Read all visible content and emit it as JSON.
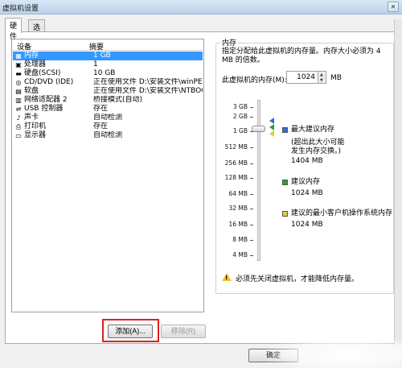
{
  "window": {
    "title": "虚拟机设置",
    "close_glyph": "✕"
  },
  "tabs": [
    {
      "label": "硬件",
      "active": true
    },
    {
      "label": "选项",
      "active": false
    }
  ],
  "device_list": {
    "headers": {
      "device": "设备",
      "summary": "摘要"
    },
    "rows": [
      {
        "icon": "memory-icon",
        "glyph": "▦",
        "name": "内存",
        "summary": "1 GB",
        "selected": true
      },
      {
        "icon": "cpu-icon",
        "glyph": "▣",
        "name": "处理器",
        "summary": "1",
        "selected": false
      },
      {
        "icon": "harddisk-icon",
        "glyph": "▬",
        "name": "硬盘(SCSI)",
        "summary": "10 GB",
        "selected": false
      },
      {
        "icon": "cd-icon",
        "glyph": "◎",
        "name": "CD/DVD (IDE)",
        "summary": "正在使用文件 D:\\安装文件\\winPE\\...",
        "selected": false
      },
      {
        "icon": "floppy-icon",
        "glyph": "▤",
        "name": "软盘",
        "summary": "正在使用文件 D:\\安装文件\\NTBOOT...",
        "selected": false
      },
      {
        "icon": "network-icon",
        "glyph": "▥",
        "name": "网络适配器 2",
        "summary": "桥接模式(自动)",
        "selected": false
      },
      {
        "icon": "usb-icon",
        "glyph": "⇌",
        "name": "USB 控制器",
        "summary": "存在",
        "selected": false
      },
      {
        "icon": "sound-icon",
        "glyph": "♪",
        "name": "声卡",
        "summary": "自动检测",
        "selected": false
      },
      {
        "icon": "printer-icon",
        "glyph": "⎙",
        "name": "打印机",
        "summary": "存在",
        "selected": false
      },
      {
        "icon": "display-icon",
        "glyph": "▭",
        "name": "显示器",
        "summary": "自动检测",
        "selected": false
      }
    ]
  },
  "buttons": {
    "add": "添加(A)...",
    "remove": "移除(R)",
    "ok": "确定"
  },
  "memory": {
    "group_title": "内存",
    "description": "指定分配给此虚拟机的内存量。内存大小必须为 4 MB 的倍数。",
    "label": "此虚拟机的内存(M):",
    "value": "1024",
    "unit": "MB",
    "scale": [
      "3 GB",
      "2 GB",
      "1 GB",
      "512 MB",
      "256 MB",
      "128 MB",
      "64 MB",
      "32 MB",
      "16 MB",
      "8 MB",
      "4 MB"
    ],
    "max_recommended": {
      "title": "最大建议内存",
      "note_line1": "(超出此大小可能",
      "note_line2": "发生内存交换。)",
      "value": "1404 MB",
      "color": "#3a6cc8"
    },
    "recommended": {
      "title": "建议内存",
      "value": "1024 MB",
      "color": "#2aa52a"
    },
    "min_guest_os": {
      "title": "建议的最小客户机操作系统内存",
      "value": "1024 MB",
      "color": "#e0cf3a"
    },
    "warning": "必须先关闭虚拟机，才能降低内存量。"
  }
}
